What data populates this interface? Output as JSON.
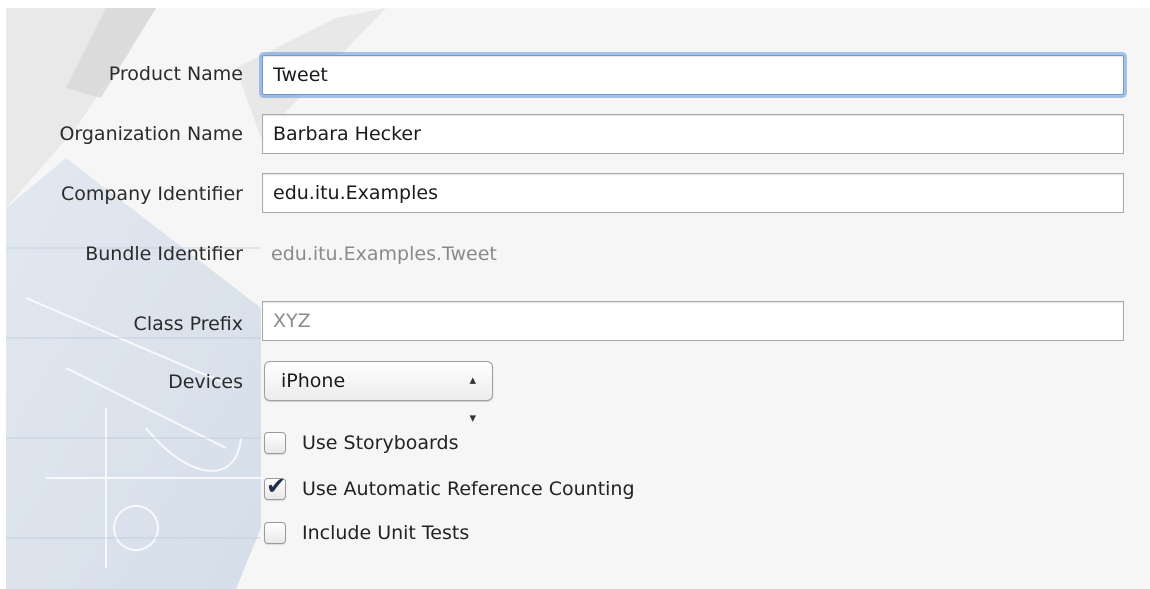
{
  "form": {
    "product_name": {
      "label": "Product Name",
      "value": "Tweet"
    },
    "organization_name": {
      "label": "Organization Name",
      "value": "Barbara Hecker"
    },
    "company_identifier": {
      "label": "Company Identifier",
      "value": "edu.itu.Examples"
    },
    "bundle_identifier": {
      "label": "Bundle Identifier",
      "value": "edu.itu.Examples.Tweet"
    },
    "class_prefix": {
      "label": "Class Prefix",
      "value": "",
      "placeholder": "XYZ"
    },
    "devices": {
      "label": "Devices",
      "selected": "iPhone"
    }
  },
  "options": [
    {
      "label": "Use Storyboards",
      "checked": false
    },
    {
      "label": "Use Automatic Reference Counting",
      "checked": true
    },
    {
      "label": "Include Unit Tests",
      "checked": false
    }
  ],
  "icons": {
    "popup_arrows": "up-down-chevron-icon",
    "checkmark": "checkmark-icon",
    "background_art": "blueprint-hammer-icon"
  },
  "colors": {
    "focus_ring": "#6f9bd2",
    "panel_background": "#f6f6f6"
  }
}
